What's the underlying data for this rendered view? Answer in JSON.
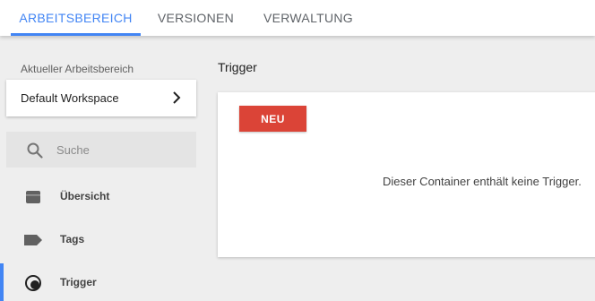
{
  "tabs": [
    {
      "label": "ARBEITSBEREICH",
      "active": true
    },
    {
      "label": "VERSIONEN",
      "active": false
    },
    {
      "label": "VERWALTUNG",
      "active": false
    }
  ],
  "sidebar": {
    "workspace_caption": "Aktueller Arbeitsbereich",
    "workspace_name": "Default Workspace",
    "search_placeholder": "Suche",
    "items": [
      {
        "label": "Übersicht",
        "icon": "folder-icon",
        "active": false
      },
      {
        "label": "Tags",
        "icon": "tag-icon",
        "active": false
      },
      {
        "label": "Trigger",
        "icon": "trigger-icon",
        "active": true
      }
    ]
  },
  "main": {
    "title": "Trigger",
    "new_button_label": "NEU",
    "empty_message": "Dieser Container enthält keine Trigger."
  },
  "colors": {
    "accent": "#4285f4",
    "new_button": "#db4437"
  }
}
